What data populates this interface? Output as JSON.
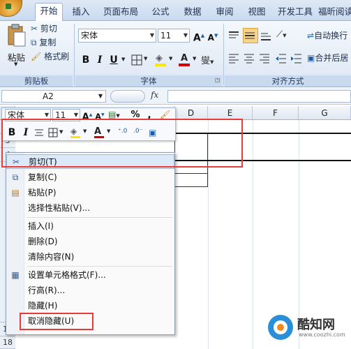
{
  "tabs": [
    "开始",
    "插入",
    "页面布局",
    "公式",
    "数据",
    "审阅",
    "视图",
    "开发工具",
    "福昕阅读"
  ],
  "clipboard": {
    "paste": "粘贴",
    "cut": "剪切",
    "copy": "复制",
    "format_painter": "格式刷",
    "label": "剪贴板"
  },
  "font_group": {
    "font_name": "宋体",
    "font_size": "11",
    "bold": "B",
    "italic": "I",
    "underline": "U",
    "label": "字体",
    "font_color_glyph": "A",
    "grow": "A",
    "shrink": "A",
    "phonetic": "燮"
  },
  "align_group": {
    "wrap": "自动换行",
    "merge": "合并后居",
    "label": "对齐方式"
  },
  "formula_bar": {
    "cell_ref": "A2",
    "fx": "fx"
  },
  "columns": [
    "D",
    "E",
    "F",
    "G"
  ],
  "rows": [
    "3",
    "4",
    "17",
    "18"
  ],
  "mini_toolbar": {
    "font": "宋体",
    "size": "11",
    "percent": "%",
    "comma": ",",
    "bold": "B",
    "italic": "I",
    "grow": "A",
    "shrink": "A",
    "font_color": "A"
  },
  "menu": {
    "items": [
      {
        "label": "剪切(T)",
        "icon": "scissors-icon"
      },
      {
        "label": "复制(C)",
        "icon": "copy-icon"
      },
      {
        "label": "粘贴(P)",
        "icon": "paste-icon"
      },
      {
        "label": "选择性粘贴(V)...",
        "icon": ""
      },
      {
        "label": "插入(I)",
        "icon": ""
      },
      {
        "label": "删除(D)",
        "icon": ""
      },
      {
        "label": "清除内容(N)",
        "icon": ""
      },
      {
        "label": "设置单元格格式(F)...",
        "icon": "format-cells-icon"
      },
      {
        "label": "行高(R)...",
        "icon": ""
      },
      {
        "label": "隐藏(H)",
        "icon": ""
      },
      {
        "label": "取消隐藏(U)",
        "icon": ""
      }
    ]
  },
  "watermark": {
    "name": "酷知网",
    "url": "www.coozhi.com"
  },
  "colors": {
    "highlight_red": "#e53b3b",
    "ribbon_blue": "#dce7f4",
    "font_red": "#d40000",
    "fill_yellow": "#ffe600"
  }
}
